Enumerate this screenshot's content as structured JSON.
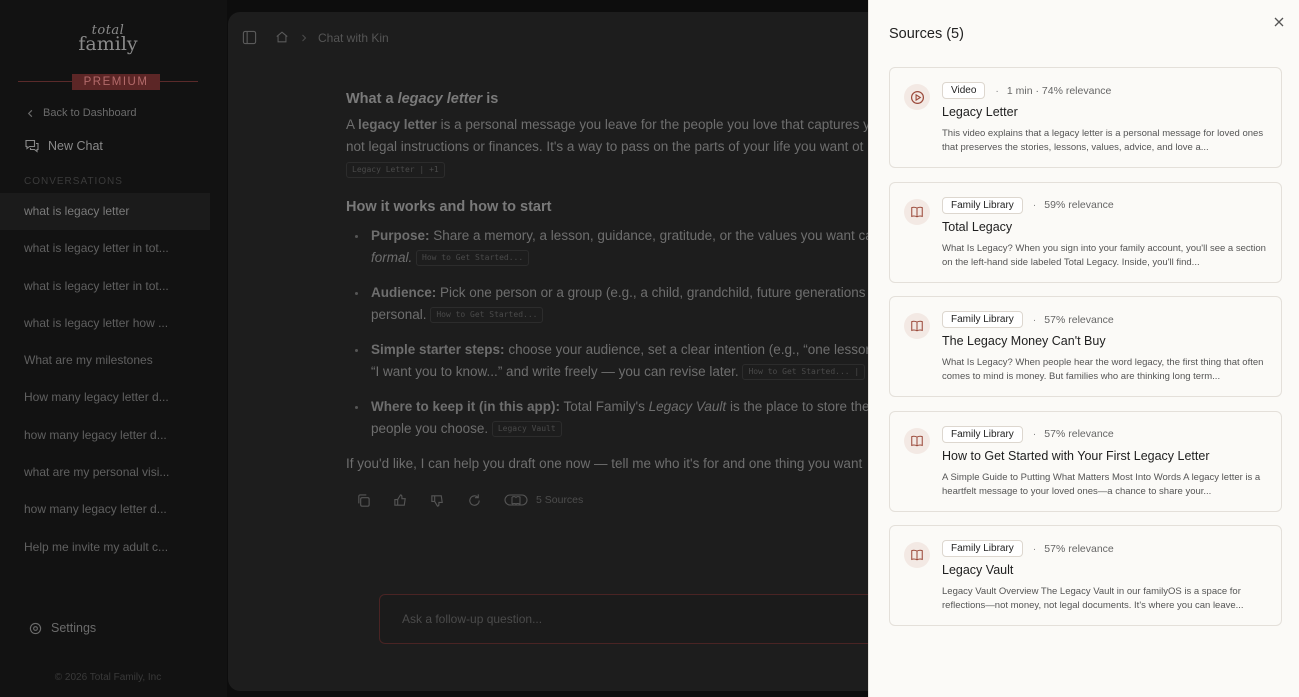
{
  "brand": {
    "logo_line1": "total",
    "logo_line2": "family",
    "tier": "PREMIUM"
  },
  "sidebar": {
    "back_label": "Back to Dashboard",
    "new_chat_label": "New Chat",
    "conversations_heading": "CONVERSATIONS",
    "conversations": [
      "what is legacy letter",
      "what is legacy letter in tot...",
      "what is legacy letter in tot...",
      "what is legacy letter how ...",
      "What are my milestones",
      "How many legacy letter d...",
      "how many legacy letter d...",
      "what are my personal visi...",
      "how many legacy letter d...",
      "Help me invite my adult c..."
    ],
    "active_index": 0,
    "settings_label": "Settings",
    "copyright": "© 2026 Total Family, Inc"
  },
  "topbar": {
    "breadcrumb": "Chat with Kin"
  },
  "message": {
    "h1_prefix": "What a ",
    "h1_em": "legacy letter",
    "h1_suffix": " is",
    "p1_a": "A ",
    "p1_bold": "legacy letter",
    "p1_b": " is a personal message you leave for the people you love that captures y",
    "p1_line2": "not legal instructions or finances. It's a way to pass on the parts of your life you want ot",
    "p1_chip": "Legacy Letter | +1",
    "h2": "How it works and how to start",
    "bullets": [
      {
        "bold": "Purpose:",
        "text": " Share a memory, a lesson, guidance, gratitude, or the values you want ca",
        "line2": "formal.",
        "chip": "How to Get Started..."
      },
      {
        "bold": "Audience:",
        "text": " Pick one person or a group (e.g., a child, grandchild, future generations",
        "line2": "personal.",
        "chip": "How to Get Started..."
      },
      {
        "bold": "Simple starter steps:",
        "text": " choose your audience, set a clear intention (e.g., “one lessor",
        "line2": "“I want you to know...” and write freely — you can revise later.",
        "chip": "How to Get Started... |"
      },
      {
        "bold": "Where to keep it (in this app):",
        "text": " Total Family's ",
        "em": "Legacy Vault",
        "text2": " is the place to store the",
        "line2": "people you choose.",
        "chip": "Legacy Vault"
      }
    ],
    "closing": "If you'd like, I can help you draft one now — tell me who it's for and one thing you want",
    "sources_count_label": "5 Sources"
  },
  "composer": {
    "placeholder": "Ask a follow-up question..."
  },
  "drawer": {
    "title": "Sources (5)",
    "sources": [
      {
        "type": "Video",
        "icon": "play-circle-icon",
        "meta": "1 min · 74% relevance",
        "title": "Legacy Letter",
        "desc": "This video explains that a legacy letter is a personal message for loved ones that preserves the stories, lessons, values, advice, and love a..."
      },
      {
        "type": "Family Library",
        "icon": "book-open-icon",
        "meta": "59% relevance",
        "title": "Total Legacy",
        "desc": "What Is Legacy? When you sign into your family account, you'll see a section on the left-hand side labeled Total Legacy. Inside, you'll find..."
      },
      {
        "type": "Family Library",
        "icon": "book-open-icon",
        "meta": "57% relevance",
        "title": "The Legacy Money Can't Buy",
        "desc": "What Is Legacy? When people hear the word legacy, the first thing that often comes to mind is money. But families who are thinking long term..."
      },
      {
        "type": "Family Library",
        "icon": "book-open-icon",
        "meta": "57% relevance",
        "title": "How to Get Started with Your First Legacy Letter",
        "desc": "A Simple Guide to Putting What Matters Most Into Words A legacy letter is a heartfelt message to your loved ones—a chance to share your..."
      },
      {
        "type": "Family Library",
        "icon": "book-open-icon",
        "meta": "57% relevance",
        "title": "Legacy Vault",
        "desc": "Legacy Vault Overview The Legacy Vault in our familyOS is a space for reflections—not money, not legal documents. It's where you can leave..."
      }
    ]
  },
  "colors": {
    "accent": "#9c4b3c",
    "premium_bg": "#5c2626",
    "drawer_bg": "#fbfaf7",
    "overlay_bg": "#121212"
  }
}
